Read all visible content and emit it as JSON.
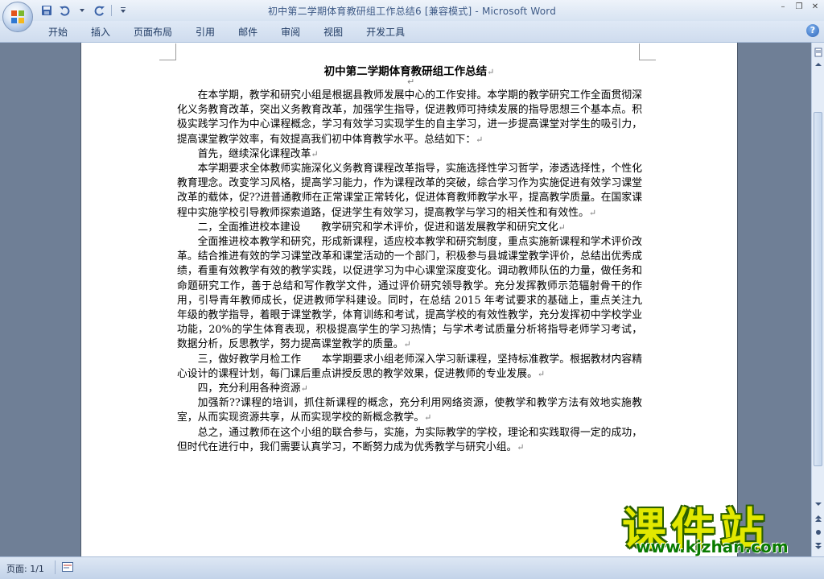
{
  "app": {
    "window_title": "初中第二学期体育教研组工作总结6 [兼容模式] - Microsoft Word",
    "window_controls": [
      "–",
      "❐",
      "✕"
    ]
  },
  "ribbon": {
    "tabs": [
      "开始",
      "插入",
      "页面布局",
      "引用",
      "邮件",
      "审阅",
      "视图",
      "开发工具"
    ],
    "help_label": "?"
  },
  "document": {
    "title": "初中第二学期体育教研组工作总结",
    "paragraph_mark": "↵",
    "paragraphs": [
      "在本学期，教学和研究小组是根据县教师发展中心的工作安排。本学期的教学研究工作全面贯彻深化义务教育改革，突出义务教育改革，加强学生指导，促进教师可持续发展的指导思想三个基本点。积极实践学习作为中心课程概念，学习有效学习实现学生的自主学习，进一步提高课堂对学生的吸引力，提高课堂教学效率，有效提高我们初中体育教学水平。总结如下：",
      "首先，继续深化课程改革",
      "本学期要求全体教师实施深化义务教育课程改革指导，实施选择性学习哲学，渗透选择性，个性化教育理念。改变学习风格，提高学习能力，作为课程改革的突破，综合学习作为实施促进有效学习课堂改革的载体，促??进普通教师在正常课堂正常转化，促进体育教师教学水平，提高教学质量。在国家课程中实施学校引导教师探索道路，促进学生有效学习，提高教学与学习的相关性和有效性。",
      "二，全面推进校本建设　　教学研究和学术评价，促进和谐发展教学和研究文化",
      "全面推进校本教学和研究，形成新课程，适应校本教学和研究制度，重点实施新课程和学术评价改革。结合推进有效的学习课堂改革和课堂活动的一个部门，积极参与县城课堂教学评价，总结出优秀成绩，看重有效教学有效的教学实践，以促进学习为中心课堂深度变化。调动教师队伍的力量，做任务和命题研究工作，善于总结和写作教学文件，通过评价研究领导教学。充分发挥教师示范辐射骨干的作用，引导青年教师成长，促进教师学科建设。同时，在总结 2015 年考试要求的基础上，重点关注九年级的教学指导，着眼于课堂教学，体育训练和考试，提高学校的有效性教学，充分发挥初中学校学业功能，20%的学生体育表现，积极提高学生的学习热情；与学术考试质量分析将指导老师学习考试，数据分析，反思教学，努力提高课堂教学的质量。",
      "三，做好教学月检工作　　本学期要求小组老师深入学习新课程，坚持标准教学。根据教材内容精心设计的课程计划，每门课后重点讲授反思的教学效果，促进教师的专业发展。",
      "四，充分利用各种资源",
      "加强新??课程的培训，抓住新课程的概念，充分利用网络资源，使教学和教学方法有效地实施教室，从而实现资源共享，从而实现学校的新概念教学。",
      "总之，通过教师在这个小组的联合参与，实施，为实际教学的学校，理论和实践取得一定的成功，但时代在进行中，我们需要认真学习，不断努力成为优秀教学与研究小组。"
    ]
  },
  "statusbar": {
    "page_count": "页面: 1/1"
  },
  "watermark": {
    "main": "课件站",
    "url": "www.kjzhan.com"
  },
  "colors": {
    "title_text": "#3e5a86",
    "ribbon_bg": "#cfdcee",
    "doc_background": "#6f7f96",
    "watermark_yellow": "#e2e800",
    "watermark_green": "#0a7b00"
  }
}
